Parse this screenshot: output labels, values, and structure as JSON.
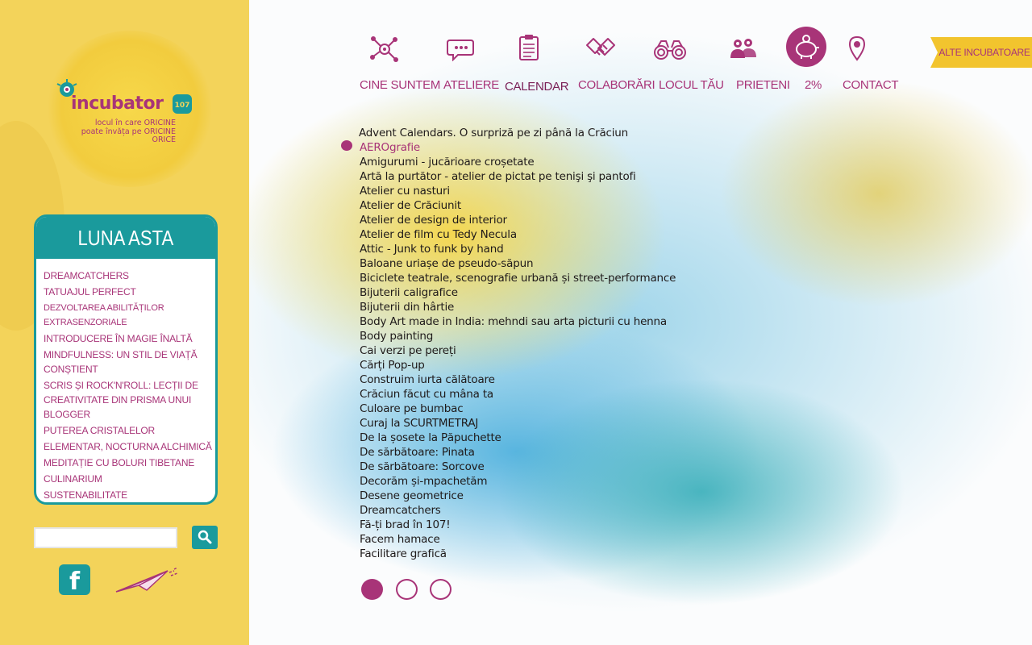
{
  "brand": {
    "logo_text": "incubator",
    "logo_badge": "107",
    "tagline_lines": [
      "locul în care ORICINE",
      "poate învăța pe ORICINE",
      "ORICE"
    ]
  },
  "nav": {
    "items": [
      {
        "label": "CINE SUNTEM",
        "icon": "molecule-icon"
      },
      {
        "label": "ATELIERE",
        "icon": "speech-bubble-icon"
      },
      {
        "label": "CALENDAR",
        "icon": "clipboard-icon",
        "active": true
      },
      {
        "label": "COLABORĂRI",
        "icon": "handshake-icon"
      },
      {
        "label": "LOCUL TĂU",
        "icon": "binoculars-icon"
      },
      {
        "label": "PRIETENI",
        "icon": "people-icon"
      },
      {
        "label": "2%",
        "icon": "piggy-bank-icon"
      },
      {
        "label": "CONTACT",
        "icon": "map-pin-icon"
      }
    ],
    "alte_label": "ALTE INCUBATOARE"
  },
  "luna": {
    "title": "LUNA ASTA",
    "items": [
      "DREAMCATCHERS",
      "TATUAJUL PERFECT",
      "DEZVOLTAREA ABILITĂȚILOR EXTRASENZORIALE",
      "INTRODUCERE ÎN MAGIE ÎNALTĂ",
      "MINDFULNESS: UN STIL DE VIAȚĂ CONȘTIENT",
      "SCRIS ȘI ROCK'N'ROLL: LECȚII DE CREATIVITATE DIN PRISMA UNUI BLOGGER",
      "PUTEREA CRISTALELOR",
      "ELEMENTAR, NOCTURNA ALCHIMICĂ",
      "MEDITAȚIE CU BOLURI TIBETANE",
      "CULINARIUM",
      "SUSTENABILITATE"
    ]
  },
  "search": {
    "value": "",
    "placeholder": ""
  },
  "social": {
    "facebook_label": "f"
  },
  "workshops": [
    "Advent Calendars. O surpriză pe zi până la Crăciun",
    "AEROgrafie",
    "Amigurumi - jucărioare croșetate",
    "Artă la purtător - atelier de pictat pe tenişi şi pantofi",
    "Atelier cu nasturi",
    "Atelier de Crăciunit",
    "Atelier de design de interior",
    "Atelier de film cu Tedy Necula",
    "Attic - Junk to funk by hand",
    "Baloane uriașe de pseudo-săpun",
    "Biciclete teatrale, scenografie urbană și street-performance",
    "Bijuterii caligrafice",
    "Bijuterii din hârtie",
    "Body Art made in India: mehndi sau arta picturii cu henna",
    "Body painting",
    "Cai verzi pe pereți",
    "Cărți Pop-up",
    "Construim iurta călătoare",
    "Crăciun făcut cu mâna ta",
    "Culoare pe bumbac",
    "Curaj la SCURTMETRAJ",
    "De la șosete la Păpuchette",
    "De sărbătoare: Pinata",
    "De sărbătoare: Sorcove",
    "Decorăm și-mpachetăm",
    "Desene geometrice",
    "Dreamcatchers",
    "Fă-ți brad în 107!",
    "Facem hamace",
    "Facilitare grafică"
  ],
  "selected_workshop_index": 1,
  "pager": {
    "pages": 3,
    "current": 1
  },
  "colors": {
    "accent": "#a83478",
    "teal": "#1a9a9c",
    "sidebar": "#f3d35a"
  }
}
